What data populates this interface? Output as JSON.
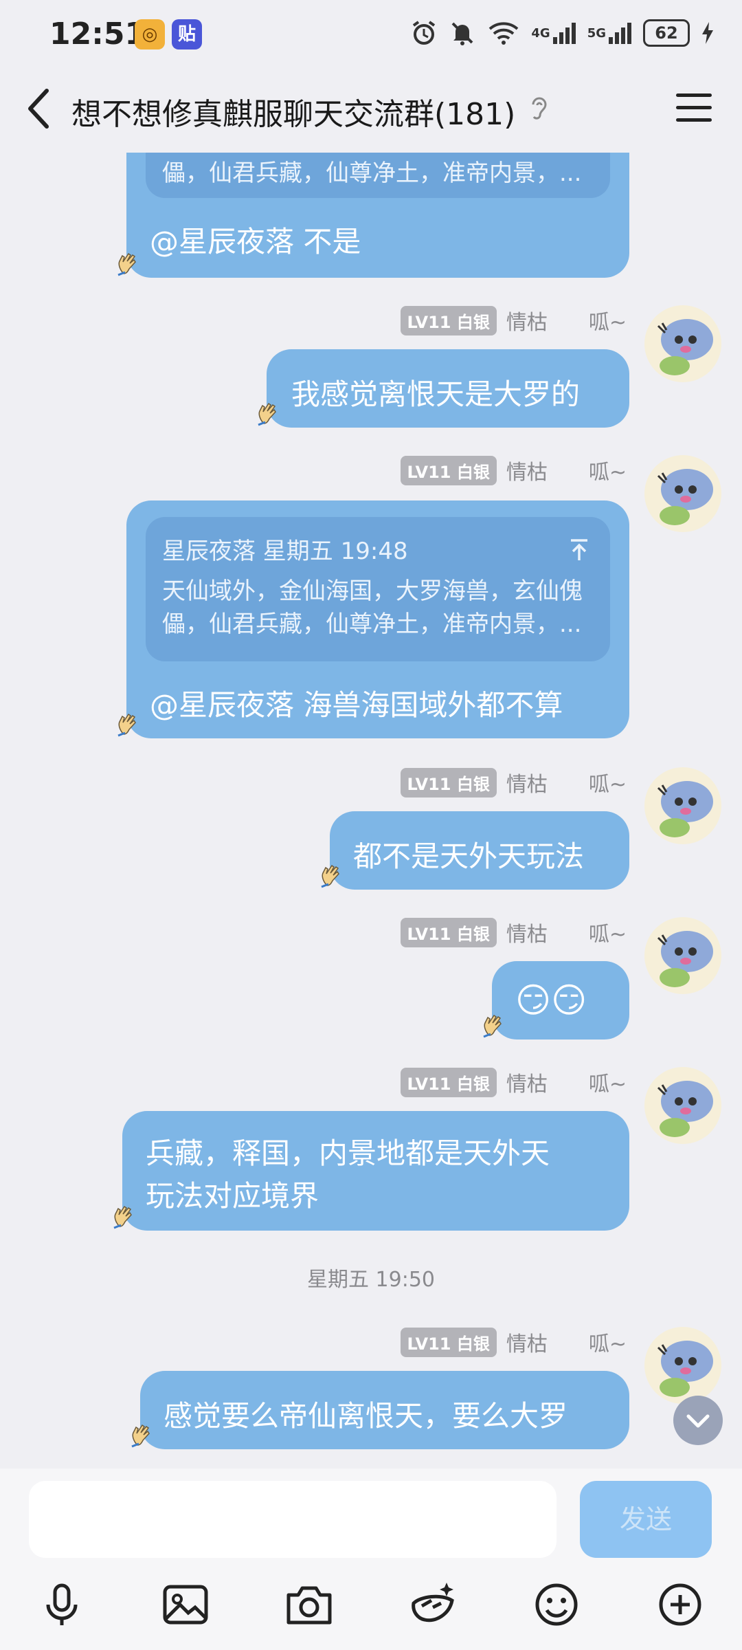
{
  "status_bar": {
    "time": "12:51",
    "app_badge_1": "◎",
    "app_badge_2": "贴",
    "signal_4g": "4G",
    "signal_5g": "5G",
    "battery": "62"
  },
  "header": {
    "title": "想不想修真麒服聊天交流群(181)"
  },
  "messages": [
    {
      "type": "quote_reply",
      "quote_tail": "儡，仙君兵藏，仙尊净土，准帝内景，...",
      "text": "@星辰夜落 不是"
    },
    {
      "type": "text",
      "level": "LV11 白银",
      "nick": "情枯",
      "nick2": "呱~",
      "text": "我感觉离恨天是大罗的"
    },
    {
      "type": "quote_reply",
      "level": "LV11 白银",
      "nick": "情枯",
      "nick2": "呱~",
      "quote_author": "星辰夜落 星期五 19:48",
      "quote_line1": "天仙域外，金仙海国，大罗海兽，玄仙傀",
      "quote_line2": "儡，仙君兵藏，仙尊净土，准帝内景，...",
      "text": "@星辰夜落 海兽海国域外都不算"
    },
    {
      "type": "text",
      "level": "LV11 白银",
      "nick": "情枯",
      "nick2": "呱~",
      "text": "都不是天外天玩法"
    },
    {
      "type": "emoji",
      "level": "LV11 白银",
      "nick": "情枯",
      "nick2": "呱~",
      "emoji": "😏😏"
    },
    {
      "type": "text",
      "level": "LV11 白银",
      "nick": "情枯",
      "nick2": "呱~",
      "line1": "兵藏，释国，内景地都是天外天",
      "line2": "玩法对应境界"
    },
    {
      "type": "text",
      "level": "LV11 白银",
      "nick": "情枯",
      "nick2": "呱~",
      "text": "感觉要么帝仙离恨天，要么大罗"
    }
  ],
  "timestamp": "星期五 19:50",
  "input": {
    "placeholder": "",
    "send_label": "发送"
  },
  "toolbar": {
    "icons": [
      "microphone-icon",
      "image-icon",
      "camera-icon",
      "magic-icon",
      "emoji-icon",
      "plus-icon"
    ]
  },
  "colors": {
    "bubble": "#7eb6e6",
    "background": "#efeff3",
    "send": "#8ec3f2"
  }
}
